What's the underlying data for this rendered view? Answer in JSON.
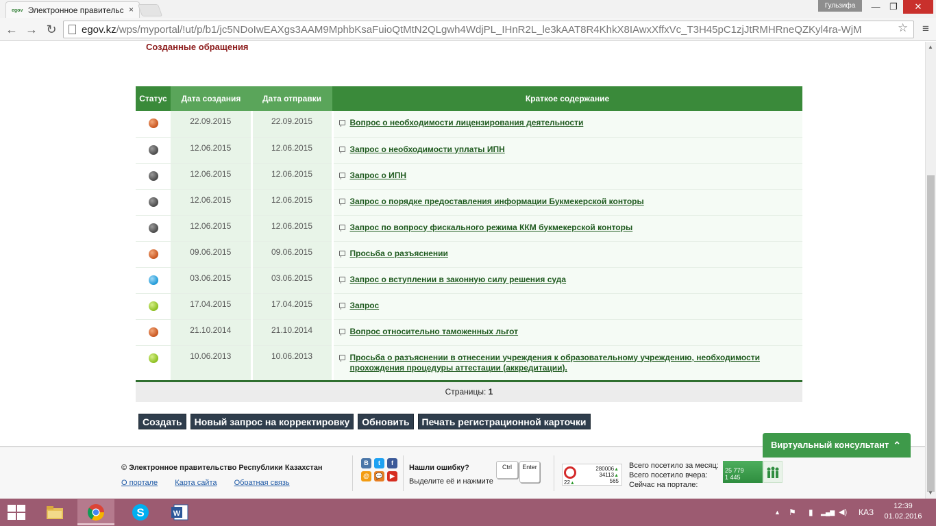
{
  "browser": {
    "tab_favicon_text": "egov",
    "tab_title": "Электронное правительс",
    "tab_close": "×",
    "user_name": "Гульзифа",
    "url_host": "egov.kz",
    "url_path": "/wps/myportal/!ut/p/b1/jc5NDoIwEAXgs3AAM9MphbKsaFuioQtMtN2QLgwh4WdjPL_IHnR2L_le3kAAT8R4KhkX8IAwxXffxVc_T3H45pC1zjJtRMHRneQZKyl4ra-WjM",
    "nav": {
      "back": "←",
      "forward": "→",
      "reload": "↻",
      "star": "☆",
      "menu": "≡"
    },
    "window_buttons": {
      "minimize": "—",
      "restore": "❐",
      "close": "✕"
    }
  },
  "page": {
    "title": "Созданные обращения",
    "table": {
      "headers": [
        "Статус",
        "Дата создания",
        "Дата отправки",
        "Краткое содержание"
      ],
      "rows": [
        {
          "status": "orange",
          "created": "22.09.2015",
          "sent": "22.09.2015",
          "summary": "Вопрос о необходимости лицензирования деятельности"
        },
        {
          "status": "gray",
          "created": "12.06.2015",
          "sent": "12.06.2015",
          "summary": "Запрос о необходимости уплаты ИПН"
        },
        {
          "status": "gray",
          "created": "12.06.2015",
          "sent": "12.06.2015",
          "summary": "Запрос о ИПН"
        },
        {
          "status": "gray",
          "created": "12.06.2015",
          "sent": "12.06.2015",
          "summary": "Запрос о порядке предоставления информации Букмекерской конторы"
        },
        {
          "status": "gray",
          "created": "12.06.2015",
          "sent": "12.06.2015",
          "summary": "Запрос по вопросу фискального режима ККМ букмекерской конторы"
        },
        {
          "status": "orange",
          "created": "09.06.2015",
          "sent": "09.06.2015",
          "summary": "Просьба о разъяснении"
        },
        {
          "status": "blue",
          "created": "03.06.2015",
          "sent": "03.06.2015",
          "summary": "Запрос о вступлении в законную силу решения суда"
        },
        {
          "status": "green",
          "created": "17.04.2015",
          "sent": "17.04.2015",
          "summary": "Запрос"
        },
        {
          "status": "orange",
          "created": "21.10.2014",
          "sent": "21.10.2014",
          "summary": "Вопрос относительно таможенных льгот"
        },
        {
          "status": "green",
          "created": "10.06.2013",
          "sent": "10.06.2013",
          "summary": "Просьба о разъяснении в отнесении учреждения к образовательному учреждению, необходимости прохождения процедуры аттестации (аккредитации)."
        }
      ]
    },
    "pager": {
      "label": "Страницы:",
      "current": "1"
    },
    "buttons": {
      "create": "Создать",
      "correction": "Новый запрос на корректировку",
      "refresh": "Обновить",
      "print": "Печать регистрационной карточки"
    }
  },
  "footer": {
    "copyright": "© Электронное правительство Республики Казахстан",
    "links": [
      "О портале",
      "Карта сайта",
      "Обратная связь"
    ],
    "social": [
      "В",
      "t",
      "f",
      "@",
      "💬",
      "▶"
    ],
    "error_title": "Нашли ошибку?",
    "error_hint": "Выделите её и нажмите",
    "keys": [
      "Ctrl",
      "Enter"
    ],
    "counter": {
      "views": "280006",
      "visitors": "34113",
      "hosts": "565",
      "online": "22"
    },
    "stats_labels": [
      "Всего посетило за месяц:",
      "Всего посетило вчера:",
      "Сейчас на портале:"
    ],
    "stats_values": [
      "25 779",
      "1 445"
    ],
    "consultant": "Виртуальный консультант",
    "consultant_chevron": "⌃"
  },
  "taskbar": {
    "tray_language": "КАЗ",
    "time": "12:39",
    "date": "01.02.2016",
    "tray_icons": [
      "▲",
      "⚑",
      "▮",
      "▂▄▆",
      "◀)"
    ]
  },
  "colors": {
    "header_green": "#3a8a3a",
    "title_red": "#8b1a1a",
    "link_green": "#1f5a1f",
    "button_dark": "#2f3d4c",
    "taskbar": "#9c5b71"
  }
}
